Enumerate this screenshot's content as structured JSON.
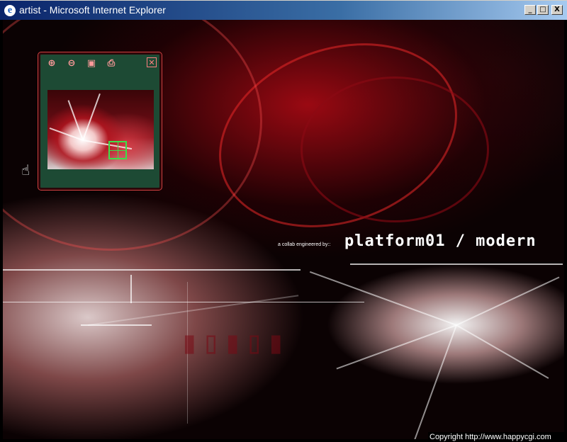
{
  "window": {
    "title": "artist - Microsoft Internet Explorer",
    "app_icon": "e",
    "controls": {
      "minimize": "_",
      "maximize": "□",
      "close": "X"
    }
  },
  "artwork": {
    "credits": "a collab engineered by::",
    "headline": "platform01 / modern"
  },
  "navigator": {
    "tools": {
      "zoom_in": "⊕",
      "zoom_out": "⊖",
      "fit": "▣",
      "print": "⎙"
    },
    "close": "✕"
  },
  "cursor": "☝",
  "footer": {
    "copyright": "Copyright  http://www.happycgi.com"
  },
  "colors": {
    "panel_bg": "#1d4a34",
    "panel_border": "#d04040",
    "viewport_marker": "#3ce04a",
    "titlebar_start": "#0a246a"
  }
}
